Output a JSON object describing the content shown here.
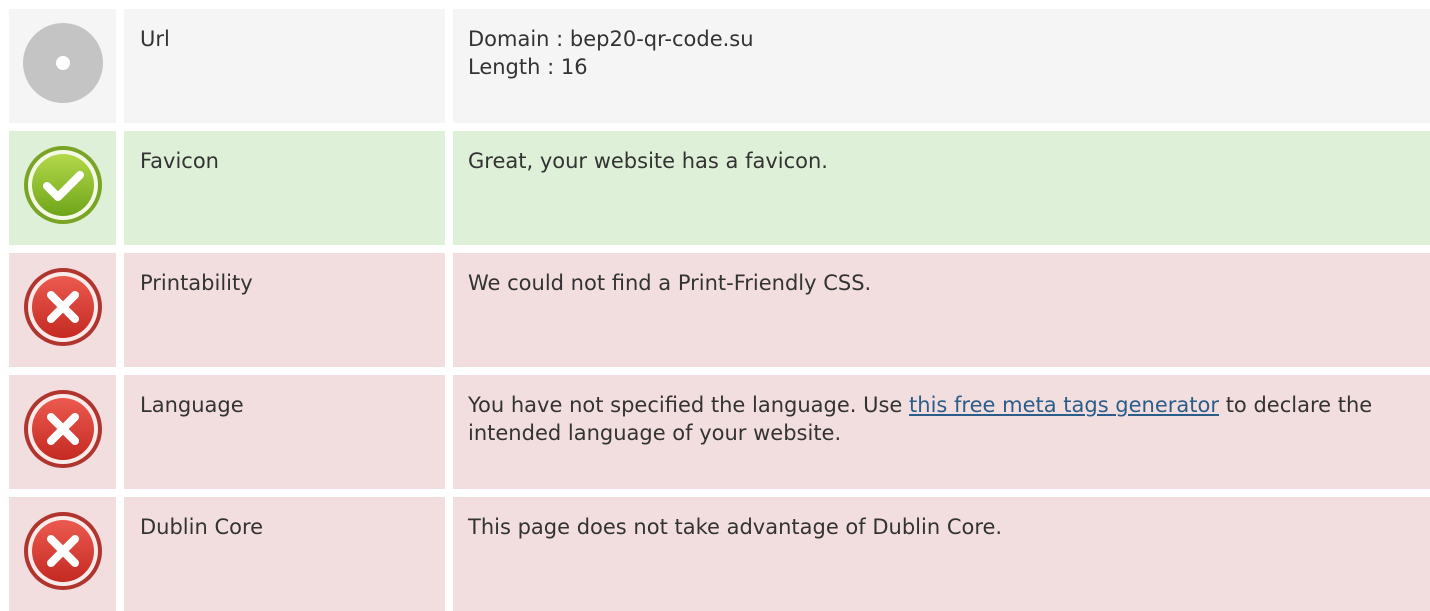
{
  "rows": [
    {
      "status": "neutral",
      "icon": "neutral-dot-icon",
      "label": "Url",
      "lines": [
        "Domain : bep20-qr-code.su",
        "Length : 16"
      ]
    },
    {
      "status": "success",
      "icon": "check-circle-icon",
      "label": "Favicon",
      "lines": [
        "Great, your website has a favicon."
      ]
    },
    {
      "status": "error",
      "icon": "x-circle-icon",
      "label": "Printability",
      "lines": [
        "We could not find a Print-Friendly CSS."
      ]
    },
    {
      "status": "error",
      "icon": "x-circle-icon",
      "label": "Language",
      "text_before": "You have not specified the language. Use ",
      "link_text": "this free meta tags generator",
      "text_after": " to declare the intended language of your website."
    },
    {
      "status": "error",
      "icon": "x-circle-icon",
      "label": "Dublin Core",
      "lines": [
        "This page does not take advantage of Dublin Core."
      ]
    }
  ],
  "colors": {
    "neutral_bg": "#f5f5f5",
    "success_bg": "#dff0d8",
    "error_bg": "#f2dede",
    "link": "#2b5d8a"
  }
}
